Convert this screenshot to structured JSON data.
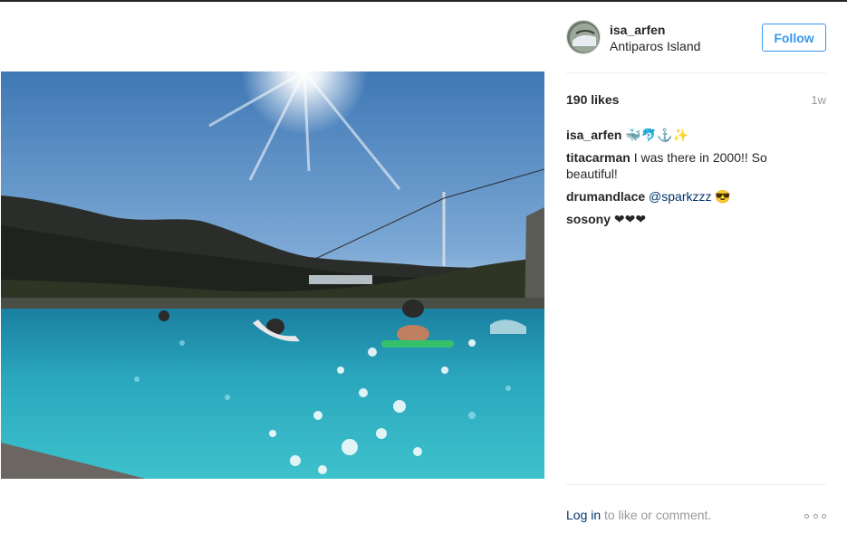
{
  "post": {
    "username": "isa_arfen",
    "location": "Antiparos Island",
    "follow_label": "Follow",
    "likes": "190 likes",
    "time": "1w",
    "photo_alt": "Pool photo",
    "comments": [
      {
        "user": "isa_arfen",
        "text": "🐳🐬⚓️✨"
      },
      {
        "user": "titacarman",
        "text": "I was there in 2000!! So beautiful!"
      },
      {
        "user": "drumandlace",
        "mention": "@sparkzzz",
        "text": "😎"
      },
      {
        "user": "sosony",
        "text": "❤❤❤"
      }
    ],
    "footer": {
      "login_label": "Log in",
      "rest": "to like or comment."
    }
  },
  "icons": {
    "more": "more-options-icon",
    "avatar": "avatar"
  },
  "colors": {
    "accent": "#3897f0",
    "link": "#003569",
    "muted": "#999999",
    "text": "#262626"
  }
}
